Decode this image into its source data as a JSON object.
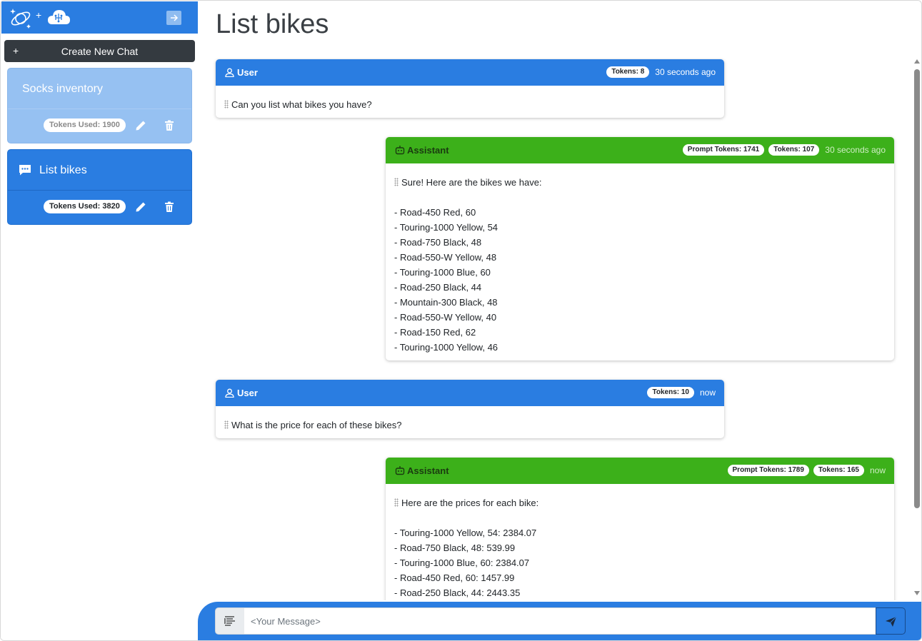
{
  "sidebar": {
    "collapse_icon": "arrow-right-icon",
    "new_chat": {
      "icon": "plus",
      "label": "Create New Chat"
    },
    "chats": [
      {
        "title": "Socks inventory",
        "tokens_label": "Tokens Used: 1900",
        "active": false
      },
      {
        "title": "List bikes",
        "tokens_label": "Tokens Used: 3820",
        "active": true
      }
    ]
  },
  "main": {
    "title": "List bikes",
    "messages": [
      {
        "role": "User",
        "tokens": "Tokens: 8",
        "time": "30 seconds ago",
        "text": "Can you list what bikes you have?"
      },
      {
        "role": "Assistant",
        "prompt_tokens": "Prompt Tokens: 1741",
        "tokens": "Tokens: 107",
        "time": "30 seconds ago",
        "text": "Sure! Here are the bikes we have:\n\n- Road-450 Red, 60\n- Touring-1000 Yellow, 54\n- Road-750 Black, 48\n- Road-550-W Yellow, 48\n- Touring-1000 Blue, 60\n- Road-250 Black, 44\n- Mountain-300 Black, 48\n- Road-550-W Yellow, 40\n- Road-150 Red, 62\n- Touring-1000 Yellow, 46"
      },
      {
        "role": "User",
        "tokens": "Tokens: 10",
        "time": "now",
        "text": "What is the price for each of these bikes?"
      },
      {
        "role": "Assistant",
        "prompt_tokens": "Prompt Tokens: 1789",
        "tokens": "Tokens: 165",
        "time": "now",
        "text": "Here are the prices for each bike:\n\n- Touring-1000 Yellow, 54: 2384.07\n- Road-750 Black, 48: 539.99\n- Touring-1000 Blue, 60: 2384.07\n- Road-450 Red, 60: 1457.99\n- Road-250 Black, 44: 2443.35"
      }
    ]
  },
  "composer": {
    "placeholder": "<Your Message>",
    "send_icon": "send-icon"
  },
  "colors": {
    "primary": "#2a7de1",
    "assistant": "#3cb01a",
    "dark_button": "#343a40",
    "inactive_card": "#96c1f2"
  }
}
